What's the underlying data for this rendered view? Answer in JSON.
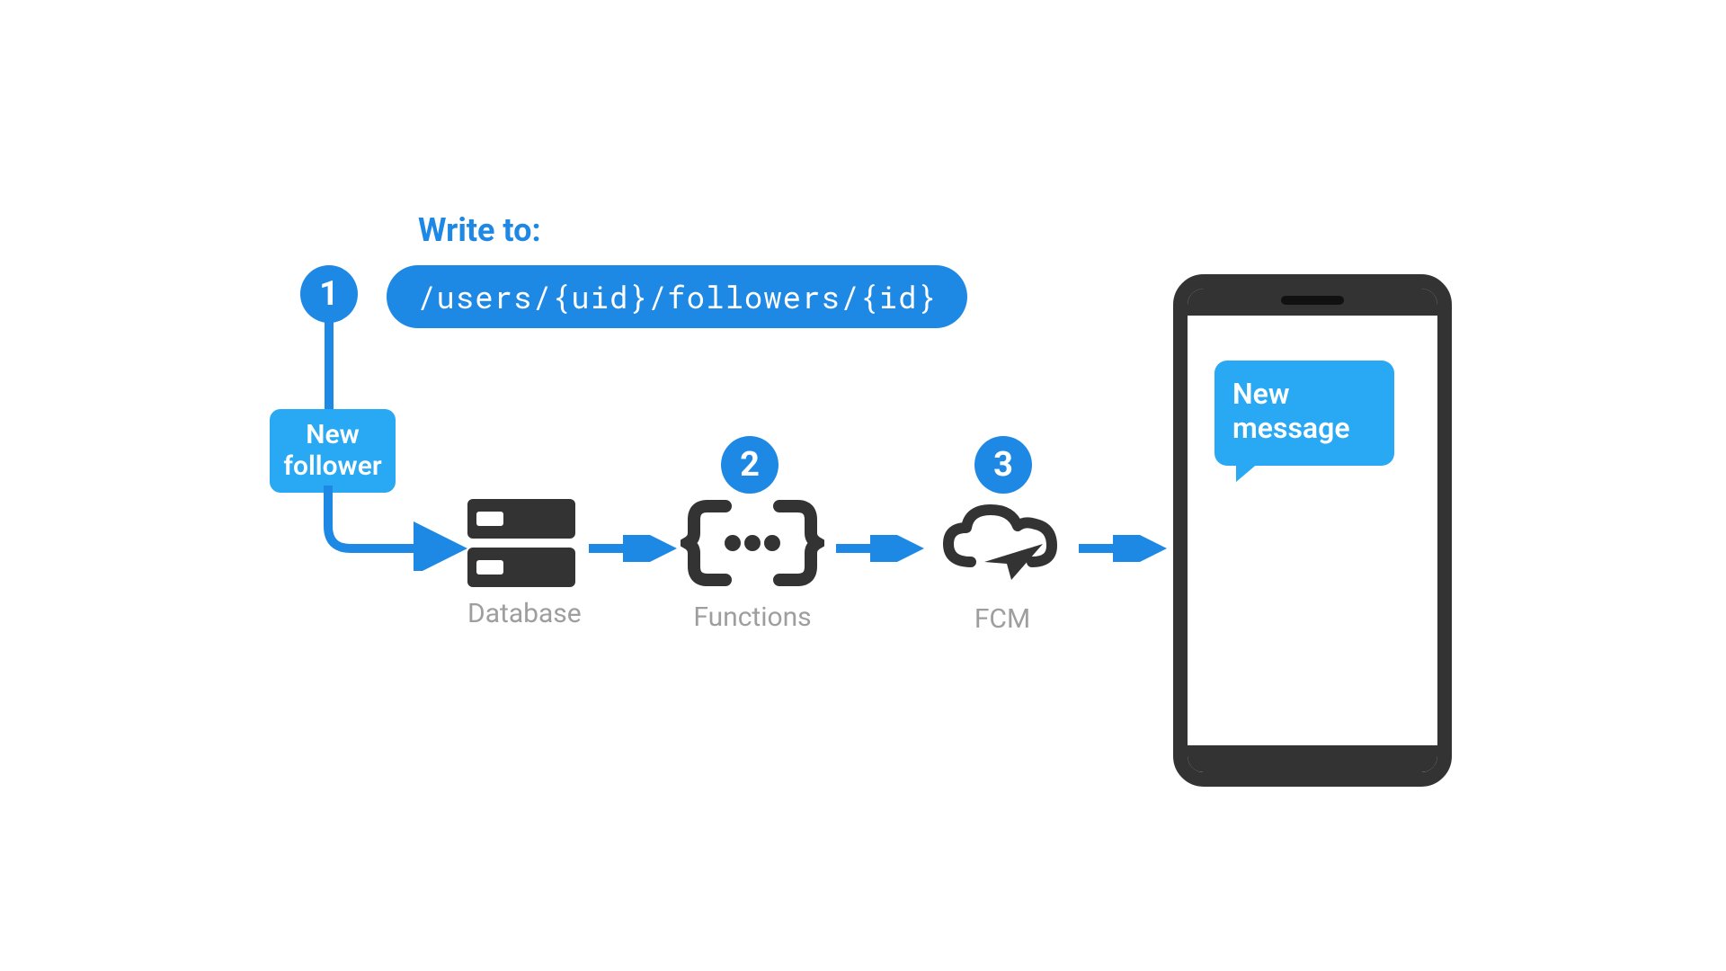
{
  "heading": "Write to:",
  "path": "/users/{uid}/followers/{id}",
  "trigger": {
    "line1": "New",
    "line2": "follower"
  },
  "badges": {
    "one": "1",
    "two": "2",
    "three": "3"
  },
  "nodes": {
    "database": "Database",
    "functions": "Functions",
    "fcm": "FCM"
  },
  "notification": {
    "line1": "New",
    "line2": "message"
  },
  "colors": {
    "primary": "#1E88E5",
    "accent": "#29A8F4",
    "iconDark": "#333333",
    "labelGray": "#9E9E9E"
  }
}
